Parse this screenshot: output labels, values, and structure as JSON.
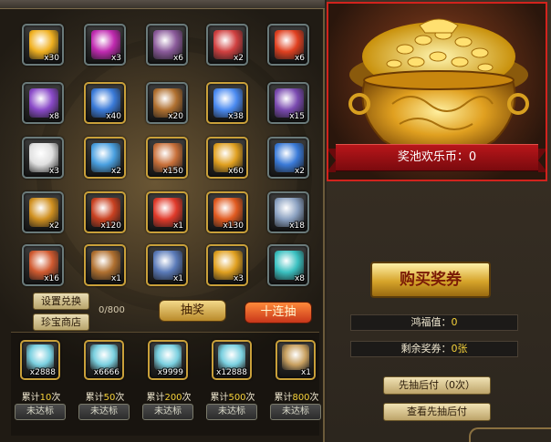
{
  "items": [
    {
      "name": "gold-orb-icon",
      "qty": "x30",
      "color": "#f0b020",
      "frame": "dark"
    },
    {
      "name": "purple-orb-icon",
      "qty": "x3",
      "color": "#c02ab0",
      "frame": "dark"
    },
    {
      "name": "treasure-chest-icon",
      "qty": "x6",
      "color": "#8a5a9a",
      "frame": "dark"
    },
    {
      "name": "scroll-card-icon",
      "qty": "x2",
      "color": "#d04040",
      "frame": "dark"
    },
    {
      "name": "fire-orb-icon",
      "qty": "x6",
      "color": "#e04020",
      "frame": "dark"
    },
    {
      "name": "purple-shield-icon",
      "qty": "x8",
      "color": "#8a4ac8",
      "frame": "dark"
    },
    {
      "name": "blue-crescent-icon",
      "qty": "x40",
      "color": "#3a7ad8",
      "frame": "gold"
    },
    {
      "name": "treasure-chest-icon",
      "qty": "x20",
      "color": "#b07030",
      "frame": "dark"
    },
    {
      "name": "blue-crystal-icon",
      "qty": "x38",
      "color": "#4a8af0",
      "frame": "gold"
    },
    {
      "name": "purple-crystal-icon",
      "qty": "x15",
      "color": "#7a4ab0",
      "frame": "dark"
    },
    {
      "name": "white-egg-icon",
      "qty": "x3",
      "color": "#e0e0e0",
      "frame": "dark"
    },
    {
      "name": "blue-shard-icon",
      "qty": "x2",
      "color": "#4aa0e0",
      "frame": "gold"
    },
    {
      "name": "orange-scroll-icon",
      "qty": "x150",
      "color": "#c8703a",
      "frame": "gold"
    },
    {
      "name": "gold-scroll-icon",
      "qty": "x60",
      "color": "#e0a020",
      "frame": "gold"
    },
    {
      "name": "blue-crescent-icon",
      "qty": "x2",
      "color": "#3a7ad8",
      "frame": "dark"
    },
    {
      "name": "gold-scroll-icon",
      "qty": "x2",
      "color": "#d09020",
      "frame": "dark"
    },
    {
      "name": "red-scroll-icon",
      "qty": "x120",
      "color": "#c84020",
      "frame": "gold"
    },
    {
      "name": "gift-box-icon",
      "qty": "x1",
      "color": "#e03a2a",
      "frame": "gold"
    },
    {
      "name": "fire-swirl-icon",
      "qty": "x130",
      "color": "#e05a20",
      "frame": "gold"
    },
    {
      "name": "silver-chest-icon",
      "qty": "x18",
      "color": "#8aa0c0",
      "frame": "dark"
    },
    {
      "name": "red-chest-icon",
      "qty": "x16",
      "color": "#d05a30",
      "frame": "dark"
    },
    {
      "name": "treasure-chest-icon",
      "qty": "x1",
      "color": "#b07030",
      "frame": "gold"
    },
    {
      "name": "blue-ingot-icon",
      "qty": "x1",
      "color": "#5a7ab8",
      "frame": "gold"
    },
    {
      "name": "gold-scroll-icon",
      "qty": "x3",
      "color": "#e0a020",
      "frame": "gold"
    },
    {
      "name": "teal-gem-icon",
      "qty": "x8",
      "color": "#3ac0c0",
      "frame": "dark"
    }
  ],
  "buttons": {
    "exchange_settings": "设置兑换",
    "treasure_shop": "珍宝商店",
    "draw_one": "抽奖",
    "draw_ten": "十连抽",
    "buy_tickets": "购买奖券",
    "draw_first_pay_later": "先抽后付（0次）",
    "view_draw_first_pay_later": "查看先抽后付"
  },
  "counter": "0/800",
  "pool": {
    "label": "奖池欢乐币：0",
    "border_color": "#d2231d"
  },
  "info": {
    "blessing_label": "鸿福值：",
    "blessing_value": "0",
    "tickets_label": "剩余奖券：",
    "tickets_value": "0张"
  },
  "rewards": [
    {
      "icon": "diamond-icon",
      "qty": "x2888",
      "cum_prefix": "累计",
      "cum_n": "10",
      "cum_suffix": "次",
      "status": "未达标",
      "color": "#7ad0e0"
    },
    {
      "icon": "diamond-icon",
      "qty": "x6666",
      "cum_prefix": "累计",
      "cum_n": "50",
      "cum_suffix": "次",
      "status": "未达标",
      "color": "#7ad0e0"
    },
    {
      "icon": "diamond-icon",
      "qty": "x9999",
      "cum_prefix": "累计",
      "cum_n": "200",
      "cum_suffix": "次",
      "status": "未达标",
      "color": "#7ad0e0"
    },
    {
      "icon": "diamond-icon",
      "qty": "x12888",
      "cum_prefix": "累计",
      "cum_n": "500",
      "cum_suffix": "次",
      "status": "未达标",
      "color": "#7ad0e0"
    },
    {
      "icon": "card-icon",
      "qty": "x1",
      "cum_prefix": "累计",
      "cum_n": "800",
      "cum_suffix": "次",
      "status": "未达标",
      "color": "#c8a060"
    }
  ]
}
